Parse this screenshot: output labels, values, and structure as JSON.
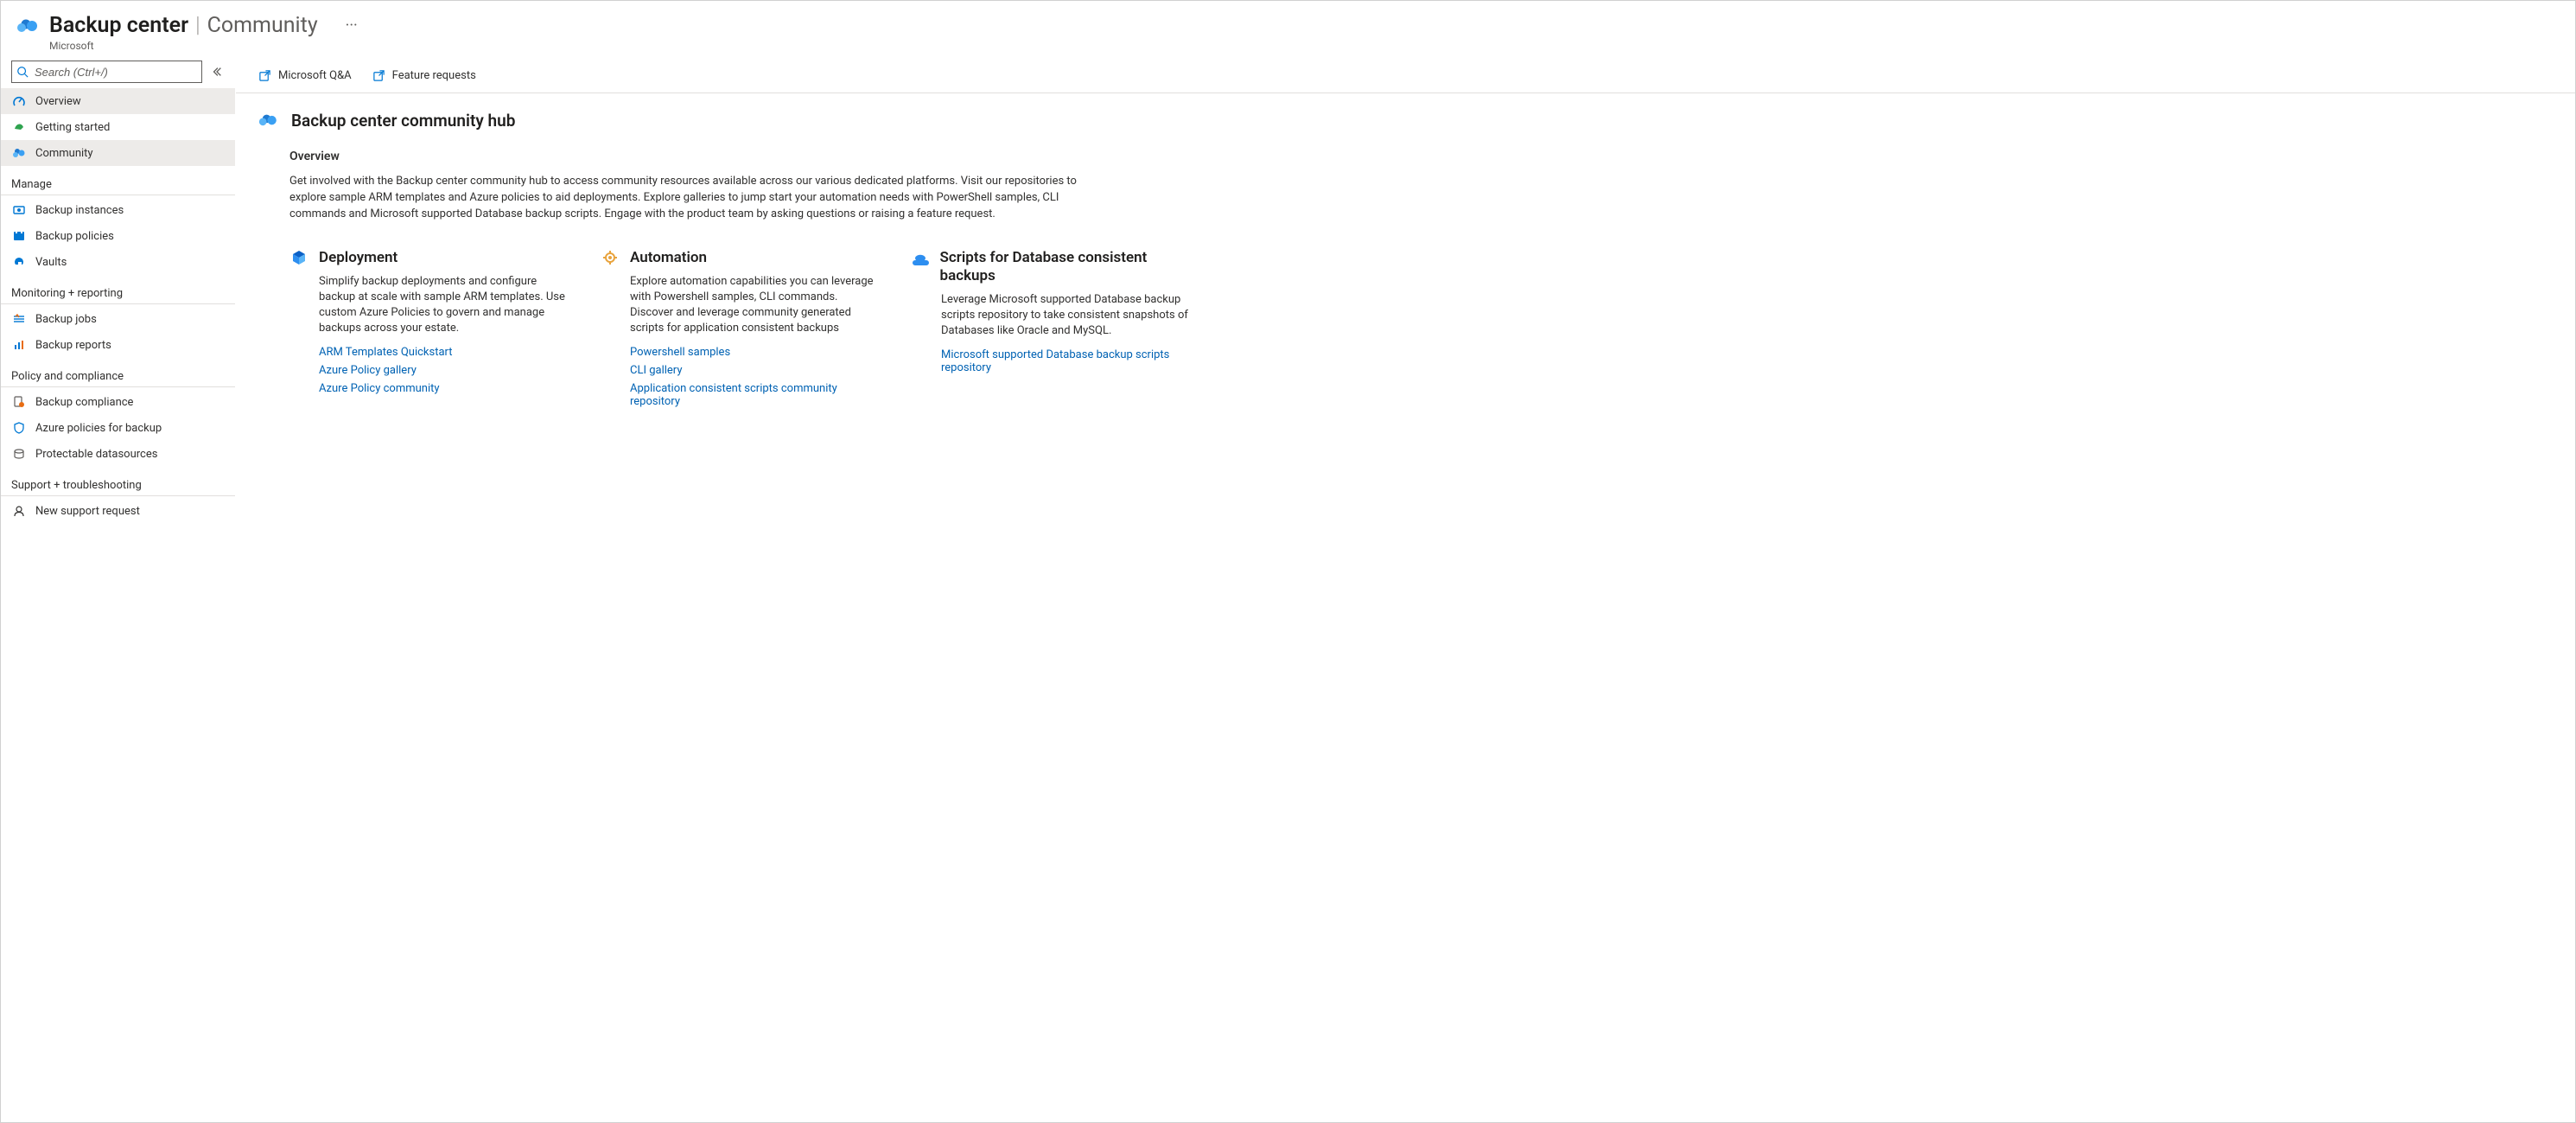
{
  "header": {
    "title": "Backup center",
    "page": "Community",
    "subtitle": "Microsoft"
  },
  "search": {
    "placeholder": "Search (Ctrl+/)"
  },
  "toolbar": {
    "qa_label": "Microsoft Q&A",
    "feature_label": "Feature requests"
  },
  "sidebar": {
    "top": [
      {
        "label": "Overview"
      },
      {
        "label": "Getting started"
      },
      {
        "label": "Community"
      }
    ],
    "sections": [
      {
        "title": "Manage",
        "items": [
          {
            "label": "Backup instances"
          },
          {
            "label": "Backup policies"
          },
          {
            "label": "Vaults"
          }
        ]
      },
      {
        "title": "Monitoring + reporting",
        "items": [
          {
            "label": "Backup jobs"
          },
          {
            "label": "Backup reports"
          }
        ]
      },
      {
        "title": "Policy and compliance",
        "items": [
          {
            "label": "Backup compliance"
          },
          {
            "label": "Azure policies for backup"
          },
          {
            "label": "Protectable datasources"
          }
        ]
      },
      {
        "title": "Support + troubleshooting",
        "items": [
          {
            "label": "New support request"
          }
        ]
      }
    ]
  },
  "hub": {
    "title": "Backup center community hub",
    "overview_heading": "Overview",
    "overview_text": "Get involved with the Backup center community hub to access community resources available across our various dedicated platforms. Visit our repositories to explore sample ARM templates and Azure policies to aid deployments. Explore galleries to jump start your automation needs with PowerShell samples, CLI commands and Microsoft supported Database backup scripts. Engage with the product team by asking questions or raising a feature request."
  },
  "cards": [
    {
      "title": "Deployment",
      "desc": "Simplify backup deployments and configure backup at scale with sample ARM templates. Use custom Azure Policies to govern and manage backups across your estate.",
      "links": [
        {
          "text": "ARM Templates Quickstart"
        },
        {
          "text": "Azure Policy gallery"
        },
        {
          "text": "Azure Policy community"
        }
      ]
    },
    {
      "title": "Automation",
      "desc": "Explore automation capabilities you can leverage with Powershell samples, CLI commands. Discover and leverage community generated scripts for application consistent backups",
      "links": [
        {
          "text": "Powershell samples"
        },
        {
          "text": "CLI gallery"
        },
        {
          "text": "Application consistent scripts community repository"
        }
      ]
    },
    {
      "title": "Scripts for Database consistent backups",
      "desc": "Leverage Microsoft supported Database backup scripts repository to take consistent snapshots of Databases like Oracle and MySQL.",
      "links": [
        {
          "text": "Microsoft supported Database backup scripts repository"
        }
      ]
    }
  ]
}
